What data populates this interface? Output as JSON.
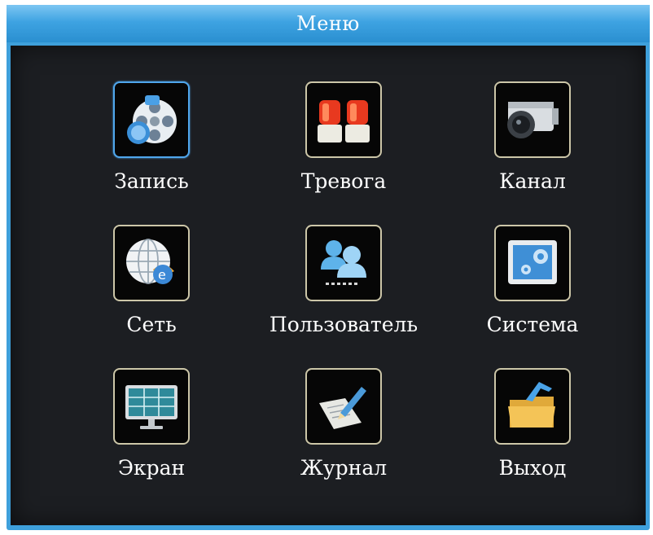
{
  "title": "Меню",
  "colors": {
    "title_bar": "#3ea3e2",
    "background": "#1c1e22",
    "tile_border": "#ccc6a8",
    "selected_border": "#4fa6ec",
    "text": "#ffffff"
  },
  "menu": {
    "selected": "Запись",
    "items": [
      {
        "label": "Запись",
        "icon": "film-reel-icon"
      },
      {
        "label": "Тревога",
        "icon": "alarm-siren-icon"
      },
      {
        "label": "Канал",
        "icon": "camera-icon"
      },
      {
        "label": "Сеть",
        "icon": "globe-network-icon"
      },
      {
        "label": "Пользователь",
        "icon": "users-icon"
      },
      {
        "label": "Система",
        "icon": "system-settings-icon"
      },
      {
        "label": "Экран",
        "icon": "monitor-icon"
      },
      {
        "label": "Журнал",
        "icon": "log-document-icon"
      },
      {
        "label": "Выход",
        "icon": "exit-folder-icon"
      }
    ]
  }
}
